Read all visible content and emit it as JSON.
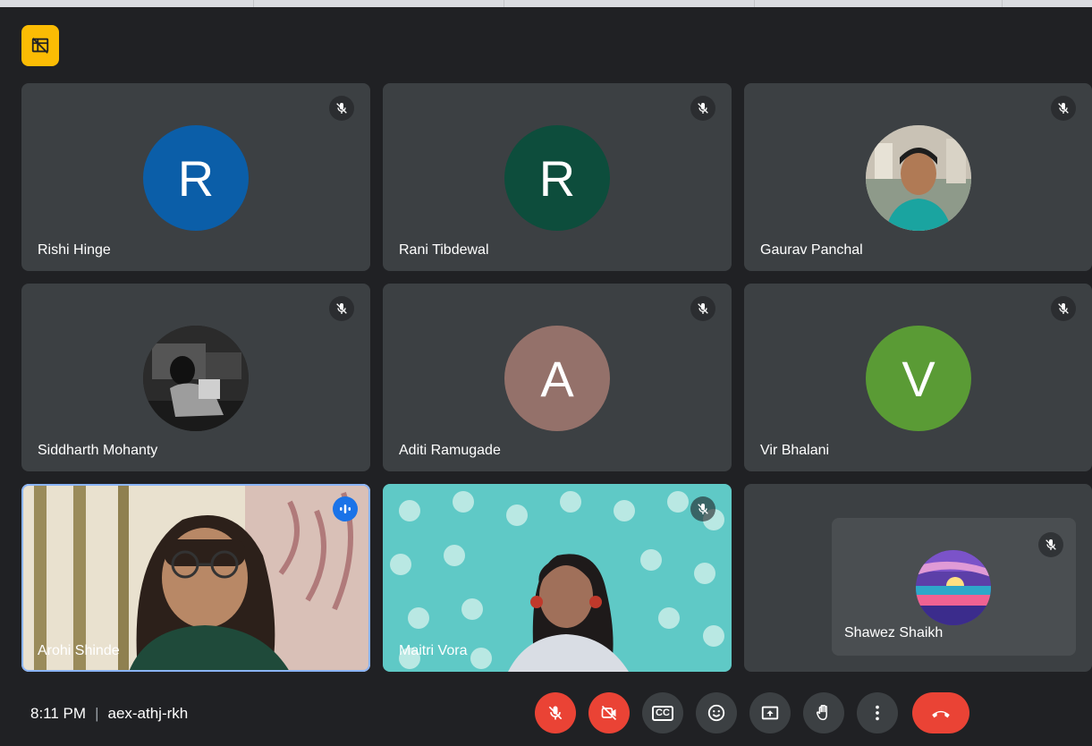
{
  "meeting": {
    "time": "8:11 PM",
    "separator": "|",
    "code": "aex-athj-rkh"
  },
  "participants": [
    {
      "name": "Rishi Hinge",
      "initial": "R",
      "color": "#0b5ea8",
      "mic": "muted"
    },
    {
      "name": "Rani Tibdewal",
      "initial": "R",
      "color": "#0d4d3c",
      "mic": "muted"
    },
    {
      "name": "Gaurav Panchal",
      "photo": "profile-photo",
      "mic": "muted"
    },
    {
      "name": "Siddharth Mohanty",
      "photo": "profile-photo",
      "mic": "muted"
    },
    {
      "name": "Aditi Ramugade",
      "initial": "A",
      "color": "#94716a",
      "mic": "muted"
    },
    {
      "name": "Vir Bhalani",
      "initial": "V",
      "color": "#5a9b35",
      "mic": "muted"
    },
    {
      "name": "Arohi Shinde",
      "video": true,
      "mic": "speaking"
    },
    {
      "name": "Maitri Vora",
      "video": true,
      "mic": "muted"
    },
    {
      "name": "Shawez Shaikh",
      "photo": "profile-photo",
      "mic": "muted"
    }
  ],
  "controls": {
    "icons": [
      "mic-off-icon",
      "camera-off-icon",
      "captions-icon",
      "emoji-icon",
      "present-icon",
      "raise-hand-icon",
      "more-options-icon",
      "end-call-icon"
    ],
    "captions_label": "CC"
  },
  "colors": {
    "speaking": "#1a73e8",
    "danger": "#ea4335",
    "pin": "#fbbc04"
  }
}
